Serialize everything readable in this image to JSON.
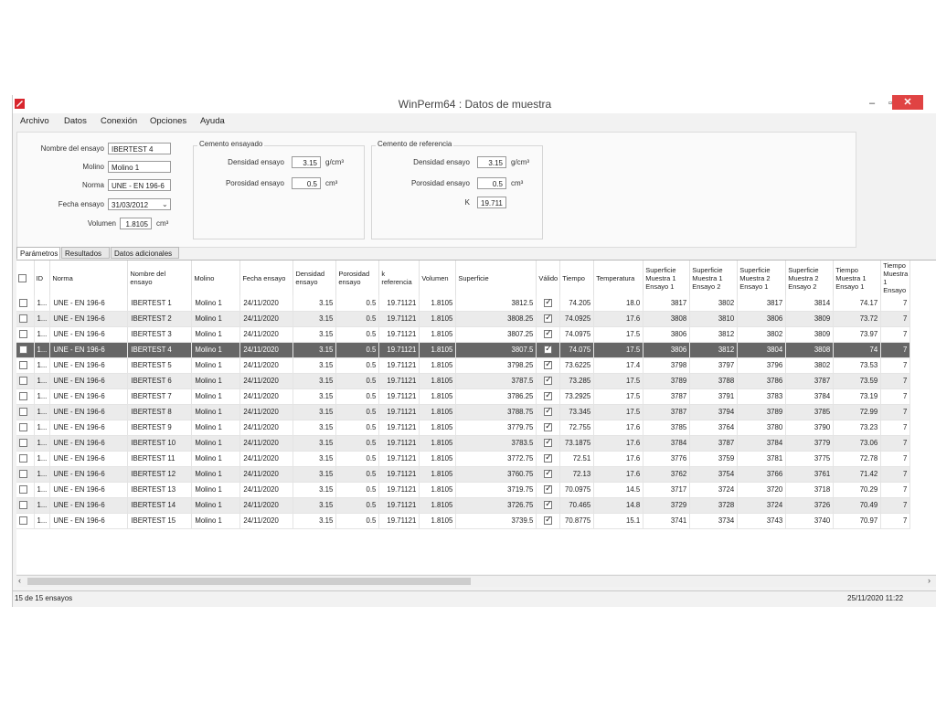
{
  "window": {
    "title": "WinPerm64 : Datos de muestra",
    "minimize": "–",
    "maximize": "▫",
    "close": "✕"
  },
  "menu": [
    "Archivo",
    "Datos",
    "Conexión",
    "Opciones",
    "Ayuda"
  ],
  "form": {
    "nombre_label": "Nombre del ensayo",
    "nombre_value": "IBERTEST 4",
    "molino_label": "Molino",
    "molino_value": "Molino 1",
    "norma_label": "Norma",
    "norma_value": "UNE - EN 196-6",
    "fecha_label": "Fecha ensayo",
    "fecha_value": "31/03/2012",
    "volumen_label": "Volumen",
    "volumen_value": "1.8105",
    "volumen_unit": "cm³"
  },
  "cemento_ensayado": {
    "title": "Cemento ensayado",
    "densidad_label": "Densidad ensayo",
    "densidad_value": "3.15",
    "densidad_unit": "g/cm³",
    "porosidad_label": "Porosidad ensayo",
    "porosidad_value": "0.5",
    "porosidad_unit": "cm³"
  },
  "cemento_referencia": {
    "title": "Cemento de referencia",
    "densidad_label": "Densidad ensayo",
    "densidad_value": "3.15",
    "densidad_unit": "g/cm³",
    "porosidad_label": "Porosidad ensayo",
    "porosidad_value": "0.5",
    "porosidad_unit": "cm³",
    "k_label": "K",
    "k_value": "19.711"
  },
  "tabs": [
    "Parámetros",
    "Resultados",
    "Datos adicionales"
  ],
  "table": {
    "headers": [
      "",
      "ID",
      "Norma",
      "Nombre del ensayo",
      "Molino",
      "Fecha ensayo",
      "Densidad ensayo",
      "Porosidad ensayo",
      "k referencia",
      "Volumen",
      "Superficie",
      "Válido",
      "Tiempo",
      "Temperatura",
      "Superficie Muestra 1 Ensayo 1",
      "Superficie Muestra 1 Ensayo 2",
      "Superficie Muestra 2 Ensayo 1",
      "Superficie Muestra 2 Ensayo 2",
      "Tiempo Muestra 1 Ensayo 1",
      "Tiempo Muestra 1 Ensayo"
    ],
    "rows": [
      [
        "",
        "1...",
        "UNE - EN 196-6",
        "IBERTEST 1",
        "Molino 1",
        "24/11/2020",
        "3.15",
        "0.5",
        "19.71121",
        "1.8105",
        "3812.5",
        "",
        "74.205",
        "18.0",
        "3817",
        "3802",
        "3817",
        "3814",
        "74.17",
        "7"
      ],
      [
        "",
        "1...",
        "UNE - EN 196-6",
        "IBERTEST 2",
        "Molino 1",
        "24/11/2020",
        "3.15",
        "0.5",
        "19.71121",
        "1.8105",
        "3808.25",
        "",
        "74.0925",
        "17.6",
        "3808",
        "3810",
        "3806",
        "3809",
        "73.72",
        "7"
      ],
      [
        "",
        "1...",
        "UNE - EN 196-6",
        "IBERTEST 3",
        "Molino 1",
        "24/11/2020",
        "3.15",
        "0.5",
        "19.71121",
        "1.8105",
        "3807.25",
        "",
        "74.0975",
        "17.5",
        "3806",
        "3812",
        "3802",
        "3809",
        "73.97",
        "7"
      ],
      [
        "",
        "1...",
        "UNE - EN 196-6",
        "IBERTEST 4",
        "Molino 1",
        "24/11/2020",
        "3.15",
        "0.5",
        "19.71121",
        "1.8105",
        "3807.5",
        "",
        "74.075",
        "17.5",
        "3806",
        "3812",
        "3804",
        "3808",
        "74",
        "7"
      ],
      [
        "",
        "1...",
        "UNE - EN 196-6",
        "IBERTEST 5",
        "Molino 1",
        "24/11/2020",
        "3.15",
        "0.5",
        "19.71121",
        "1.8105",
        "3798.25",
        "",
        "73.6225",
        "17.4",
        "3798",
        "3797",
        "3796",
        "3802",
        "73.53",
        "7"
      ],
      [
        "",
        "1...",
        "UNE - EN 196-6",
        "IBERTEST 6",
        "Molino 1",
        "24/11/2020",
        "3.15",
        "0.5",
        "19.71121",
        "1.8105",
        "3787.5",
        "",
        "73.285",
        "17.5",
        "3789",
        "3788",
        "3786",
        "3787",
        "73.59",
        "7"
      ],
      [
        "",
        "1...",
        "UNE - EN 196-6",
        "IBERTEST 7",
        "Molino 1",
        "24/11/2020",
        "3.15",
        "0.5",
        "19.71121",
        "1.8105",
        "3786.25",
        "",
        "73.2925",
        "17.5",
        "3787",
        "3791",
        "3783",
        "3784",
        "73.19",
        "7"
      ],
      [
        "",
        "1...",
        "UNE - EN 196-6",
        "IBERTEST 8",
        "Molino 1",
        "24/11/2020",
        "3.15",
        "0.5",
        "19.71121",
        "1.8105",
        "3788.75",
        "",
        "73.345",
        "17.5",
        "3787",
        "3794",
        "3789",
        "3785",
        "72.99",
        "7"
      ],
      [
        "",
        "1...",
        "UNE - EN 196-6",
        "IBERTEST 9",
        "Molino 1",
        "24/11/2020",
        "3.15",
        "0.5",
        "19.71121",
        "1.8105",
        "3779.75",
        "",
        "72.755",
        "17.6",
        "3785",
        "3764",
        "3780",
        "3790",
        "73.23",
        "7"
      ],
      [
        "",
        "1...",
        "UNE - EN 196-6",
        "IBERTEST 10",
        "Molino 1",
        "24/11/2020",
        "3.15",
        "0.5",
        "19.71121",
        "1.8105",
        "3783.5",
        "",
        "73.1875",
        "17.6",
        "3784",
        "3787",
        "3784",
        "3779",
        "73.06",
        "7"
      ],
      [
        "",
        "1...",
        "UNE - EN 196-6",
        "IBERTEST 11",
        "Molino 1",
        "24/11/2020",
        "3.15",
        "0.5",
        "19.71121",
        "1.8105",
        "3772.75",
        "",
        "72.51",
        "17.6",
        "3776",
        "3759",
        "3781",
        "3775",
        "72.78",
        "7"
      ],
      [
        "",
        "1...",
        "UNE - EN 196-6",
        "IBERTEST 12",
        "Molino 1",
        "24/11/2020",
        "3.15",
        "0.5",
        "19.71121",
        "1.8105",
        "3760.75",
        "",
        "72.13",
        "17.6",
        "3762",
        "3754",
        "3766",
        "3761",
        "71.42",
        "7"
      ],
      [
        "",
        "1...",
        "UNE - EN 196-6",
        "IBERTEST 13",
        "Molino 1",
        "24/11/2020",
        "3.15",
        "0.5",
        "19.71121",
        "1.8105",
        "3719.75",
        "",
        "70.0975",
        "14.5",
        "3717",
        "3724",
        "3720",
        "3718",
        "70.29",
        "7"
      ],
      [
        "",
        "1...",
        "UNE - EN 196-6",
        "IBERTEST 14",
        "Molino 1",
        "24/11/2020",
        "3.15",
        "0.5",
        "19.71121",
        "1.8105",
        "3726.75",
        "",
        "70.465",
        "14.8",
        "3729",
        "3728",
        "3724",
        "3726",
        "70.49",
        "7"
      ],
      [
        "",
        "1...",
        "UNE - EN 196-6",
        "IBERTEST 15",
        "Molino 1",
        "24/11/2020",
        "3.15",
        "0.5",
        "19.71121",
        "1.8105",
        "3739.5",
        "",
        "70.8775",
        "15.1",
        "3741",
        "3734",
        "3743",
        "3740",
        "70.97",
        "7"
      ]
    ],
    "selected_row": 3
  },
  "status": {
    "left": "15 de 15 ensayos",
    "right": "25/11/2020 11:22"
  }
}
